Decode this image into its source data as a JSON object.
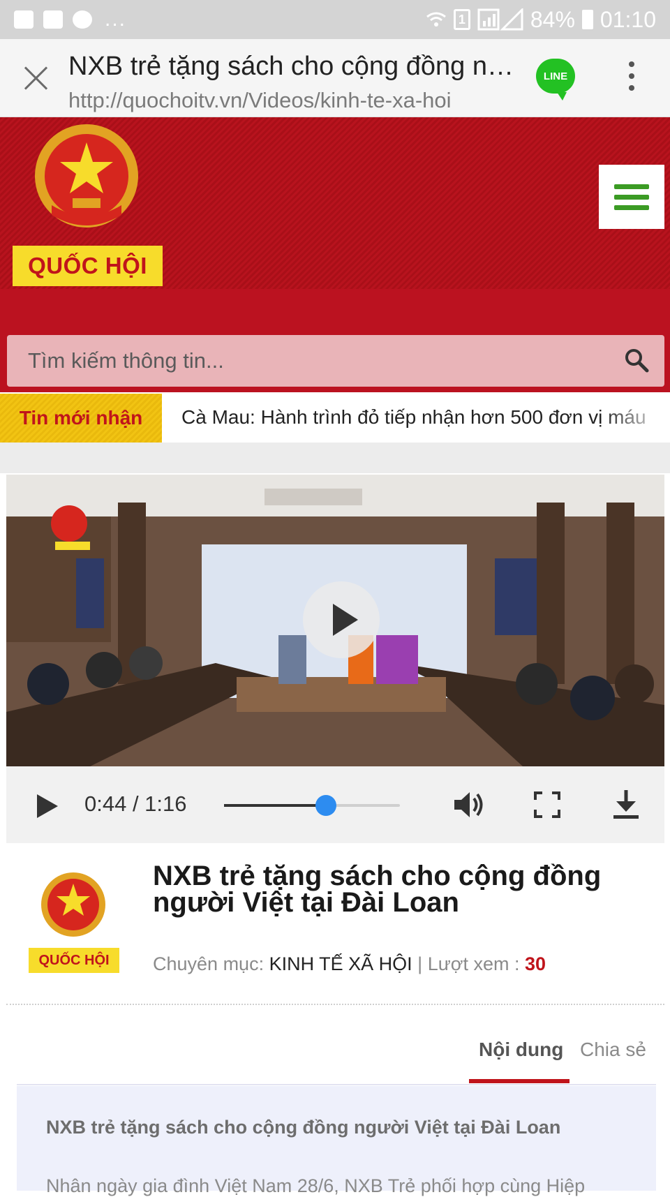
{
  "status_bar": {
    "battery": "84%",
    "time": "01:10",
    "sim": "1",
    "dots": "...",
    "icons": [
      "image-icon",
      "chat-icon",
      "chrome-icon",
      "wifi-icon",
      "signal-icon",
      "battery-icon"
    ]
  },
  "browser": {
    "title": "NXB trẻ tặng sách cho cộng đồng người Việt tại Đài Loan",
    "url": "http://quochoitv.vn/Videos/kinh-te-xa-hoi",
    "line_label": "LINE",
    "line_color": "#23c123"
  },
  "header": {
    "logo_text": "QUỐC HỘI",
    "accent_red": "#bb1220",
    "accent_yellow": "#f7dc2b",
    "menu_color": "#3b9b24"
  },
  "search": {
    "placeholder": "Tìm kiếm thông tin..."
  },
  "ticker": {
    "label": "Tin mới nhận",
    "text": "Cà Mau: Hành trình đỏ tiếp nhận hơn 500 đơn vị máu"
  },
  "video": {
    "current_time": "0:44",
    "duration": "1:16",
    "time_display": "0:44 / 1:16",
    "progress": 0.58
  },
  "article": {
    "logo_text": "QUỐC HỘI",
    "title": "NXB trẻ tặng sách cho cộng đồng người Việt tại Đài Loan",
    "category_label": "Chuyên mục:",
    "category": "KINH TẾ XÃ HỘI",
    "separator": "|",
    "views_label": "Lượt xem :",
    "views": "30"
  },
  "tabs": {
    "content": "Nội dung",
    "share": "Chia sẻ"
  },
  "content": {
    "title": "NXB trẻ tặng sách cho cộng đồng người Việt tại Đài Loan",
    "partial_line": "Nhân ngày gia đình Việt Nam 28/6, NXB Trẻ phối hợp cùng Hiệp"
  }
}
